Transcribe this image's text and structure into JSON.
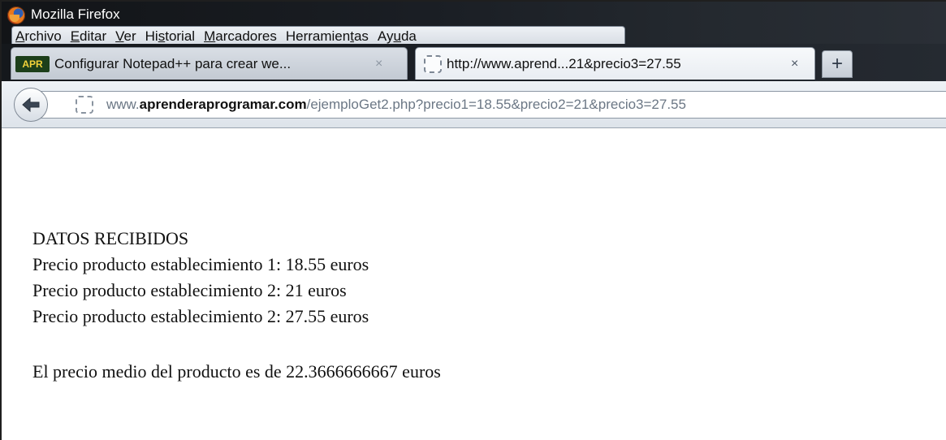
{
  "window": {
    "title": "Mozilla Firefox"
  },
  "menu": [
    {
      "pre": "",
      "key": "A",
      "post": "rchivo"
    },
    {
      "pre": "",
      "key": "E",
      "post": "ditar"
    },
    {
      "pre": "",
      "key": "V",
      "post": "er"
    },
    {
      "pre": "Hi",
      "key": "s",
      "post": "torial"
    },
    {
      "pre": "",
      "key": "M",
      "post": "arcadores"
    },
    {
      "pre": "Herramien",
      "key": "t",
      "post": "as"
    },
    {
      "pre": "Ay",
      "key": "u",
      "post": "da"
    }
  ],
  "tabs": {
    "inactive": {
      "favicon": "APR",
      "title": "Configurar Notepad++ para crear we...",
      "close": "×"
    },
    "active": {
      "title": "http://www.aprend...21&precio3=27.55",
      "close": "×"
    },
    "new_tab": "+"
  },
  "navbar": {
    "back_icon": "back-arrow-icon",
    "url_prefix": "www.",
    "url_domain": "aprenderaprogramar.com",
    "url_path": "/ejemploGet2.php?precio1=18.55&precio2=21&precio3=27.55"
  },
  "content": {
    "heading": "DATOS RECIBIDOS",
    "lines": [
      "Precio producto establecimiento 1: 18.55 euros",
      "Precio producto establecimiento 2: 21 euros",
      "Precio producto establecimiento 2: 27.55 euros"
    ],
    "average": "El precio medio del producto es de 22.3666666667 euros"
  },
  "colors": {
    "titlebar": "#1a1e24",
    "tab_active": "#f7f9fb",
    "url_domain": "#111111",
    "url_path": "#6b7785"
  }
}
